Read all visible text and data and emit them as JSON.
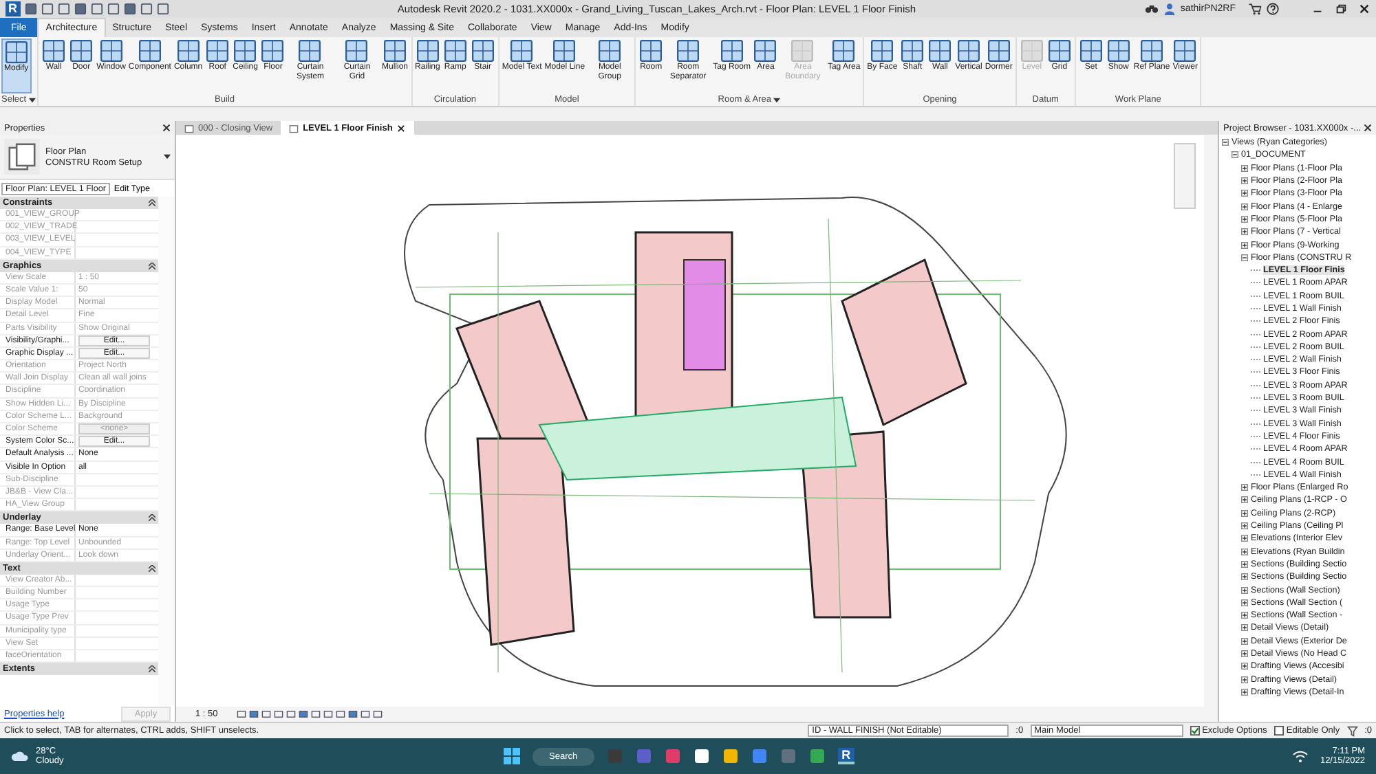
{
  "window": {
    "app_logo": "R",
    "title": "Autodesk Revit 2020.2 - 1031.XX000x - Grand_Living_Tuscan_Lakes_Arch.rvt - Floor Plan: LEVEL 1 Floor Finish",
    "user": "sathirPN2RF"
  },
  "ribbon_tabs": [
    {
      "label": "File",
      "selected": false,
      "kind": "file"
    },
    {
      "label": "Architecture",
      "selected": true,
      "kind": "tab"
    },
    {
      "label": "Structure",
      "selected": false,
      "kind": "tab"
    },
    {
      "label": "Steel",
      "selected": false,
      "kind": "tab"
    },
    {
      "label": "Systems",
      "selected": false,
      "kind": "tab"
    },
    {
      "label": "Insert",
      "selected": false,
      "kind": "tab"
    },
    {
      "label": "Annotate",
      "selected": false,
      "kind": "tab"
    },
    {
      "label": "Analyze",
      "selected": false,
      "kind": "tab"
    },
    {
      "label": "Massing & Site",
      "selected": false,
      "kind": "tab"
    },
    {
      "label": "Collaborate",
      "selected": false,
      "kind": "tab"
    },
    {
      "label": "View",
      "selected": false,
      "kind": "tab"
    },
    {
      "label": "Manage",
      "selected": false,
      "kind": "tab"
    },
    {
      "label": "Add-Ins",
      "selected": false,
      "kind": "tab"
    },
    {
      "label": "Modify",
      "selected": false,
      "kind": "tab"
    }
  ],
  "ribbon_panels": [
    {
      "title": "Select",
      "dropdown": true,
      "tools": [
        {
          "label": "Modify",
          "selected": true,
          "disabled": false
        }
      ]
    },
    {
      "title": "Build",
      "dropdown": false,
      "tools": [
        {
          "label": "Wall",
          "selected": false,
          "disabled": false
        },
        {
          "label": "Door",
          "selected": false,
          "disabled": false
        },
        {
          "label": "Window",
          "selected": false,
          "disabled": false
        },
        {
          "label": "Component",
          "selected": false,
          "disabled": false
        },
        {
          "label": "Column",
          "selected": false,
          "disabled": false
        },
        {
          "label": "Roof",
          "selected": false,
          "disabled": false
        },
        {
          "label": "Ceiling",
          "selected": false,
          "disabled": false
        },
        {
          "label": "Floor",
          "selected": false,
          "disabled": false
        },
        {
          "label": "Curtain System",
          "selected": false,
          "disabled": false
        },
        {
          "label": "Curtain Grid",
          "selected": false,
          "disabled": false
        },
        {
          "label": "Mullion",
          "selected": false,
          "disabled": false
        }
      ]
    },
    {
      "title": "Circulation",
      "dropdown": false,
      "tools": [
        {
          "label": "Railing",
          "selected": false,
          "disabled": false
        },
        {
          "label": "Ramp",
          "selected": false,
          "disabled": false
        },
        {
          "label": "Stair",
          "selected": false,
          "disabled": false
        }
      ]
    },
    {
      "title": "Model",
      "dropdown": false,
      "tools": [
        {
          "label": "Model Text",
          "selected": false,
          "disabled": false
        },
        {
          "label": "Model Line",
          "selected": false,
          "disabled": false
        },
        {
          "label": "Model Group",
          "selected": false,
          "disabled": false
        }
      ]
    },
    {
      "title": "Room & Area",
      "dropdown": true,
      "tools": [
        {
          "label": "Room",
          "selected": false,
          "disabled": false
        },
        {
          "label": "Room Separator",
          "selected": false,
          "disabled": false
        },
        {
          "label": "Tag Room",
          "selected": false,
          "disabled": false
        },
        {
          "label": "Area",
          "selected": false,
          "disabled": false
        },
        {
          "label": "Area Boundary",
          "selected": false,
          "disabled": true
        },
        {
          "label": "Tag Area",
          "selected": false,
          "disabled": false
        }
      ]
    },
    {
      "title": "Opening",
      "dropdown": false,
      "tools": [
        {
          "label": "By Face",
          "selected": false,
          "disabled": false
        },
        {
          "label": "Shaft",
          "selected": false,
          "disabled": false
        },
        {
          "label": "Wall",
          "selected": false,
          "disabled": false
        },
        {
          "label": "Vertical",
          "selected": false,
          "disabled": false
        },
        {
          "label": "Dormer",
          "selected": false,
          "disabled": false
        }
      ]
    },
    {
      "title": "Datum",
      "dropdown": false,
      "tools": [
        {
          "label": "Level",
          "selected": false,
          "disabled": true
        },
        {
          "label": "Grid",
          "selected": false,
          "disabled": false
        }
      ]
    },
    {
      "title": "Work Plane",
      "dropdown": false,
      "tools": [
        {
          "label": "Set",
          "selected": false,
          "disabled": false
        },
        {
          "label": "Show",
          "selected": false,
          "disabled": false
        },
        {
          "label": "Ref Plane",
          "selected": false,
          "disabled": false
        },
        {
          "label": "Viewer",
          "selected": false,
          "disabled": false
        }
      ]
    }
  ],
  "properties": {
    "title": "Properties",
    "type_name": "Floor Plan",
    "type_sub": "CONSTRU Room Setup",
    "instance": "Floor Plan: LEVEL 1 Floor",
    "edit_type": "Edit Type",
    "groups": [
      {
        "title": "Constraints",
        "rows": [
          {
            "label": "001_VIEW_GROUP",
            "value": "",
            "kind": "text",
            "editable": false
          },
          {
            "label": "002_VIEW_TRADE",
            "value": "",
            "kind": "text",
            "editable": false
          },
          {
            "label": "003_VIEW_LEVEL",
            "value": "",
            "kind": "text",
            "editable": false
          },
          {
            "label": "004_VIEW_TYPE",
            "value": "",
            "kind": "text",
            "editable": false
          }
        ]
      },
      {
        "title": "Graphics",
        "rows": [
          {
            "label": "View Scale",
            "value": "1 : 50",
            "kind": "text",
            "editable": false
          },
          {
            "label": "Scale Value    1:",
            "value": "50",
            "kind": "text",
            "editable": false
          },
          {
            "label": "Display Model",
            "value": "Normal",
            "kind": "text",
            "editable": false
          },
          {
            "label": "Detail Level",
            "value": "Fine",
            "kind": "text",
            "editable": false
          },
          {
            "label": "Parts Visibility",
            "value": "Show Original",
            "kind": "text",
            "editable": false
          },
          {
            "label": "Visibility/Graphi...",
            "value": "Edit...",
            "kind": "button",
            "editable": true
          },
          {
            "label": "Graphic Display ...",
            "value": "Edit...",
            "kind": "button",
            "editable": true
          },
          {
            "label": "Orientation",
            "value": "Project North",
            "kind": "text",
            "editable": false
          },
          {
            "label": "Wall Join Display",
            "value": "Clean all wall joins",
            "kind": "text",
            "editable": false
          },
          {
            "label": "Discipline",
            "value": "Coordination",
            "kind": "text",
            "editable": false
          },
          {
            "label": "Show Hidden Li...",
            "value": "By Discipline",
            "kind": "text",
            "editable": false
          },
          {
            "label": "Color Scheme L...",
            "value": "Background",
            "kind": "text",
            "editable": false
          },
          {
            "label": "Color Scheme",
            "value": "<none>",
            "kind": "button",
            "editable": false
          },
          {
            "label": "System Color Sc...",
            "value": "Edit...",
            "kind": "button",
            "editable": true
          },
          {
            "label": "Default Analysis ...",
            "value": "None",
            "kind": "text",
            "editable": true
          },
          {
            "label": "Visible In Option",
            "value": "all",
            "kind": "text",
            "editable": true
          },
          {
            "label": "Sub-Discipline",
            "value": "",
            "kind": "text",
            "editable": false
          },
          {
            "label": "JB&B - View Cla...",
            "value": "",
            "kind": "text",
            "editable": false
          },
          {
            "label": "HA_View Group",
            "value": "",
            "kind": "text",
            "editable": false
          }
        ]
      },
      {
        "title": "Underlay",
        "rows": [
          {
            "label": "Range: Base Level",
            "value": "None",
            "kind": "text",
            "editable": true
          },
          {
            "label": "Range: Top Level",
            "value": "Unbounded",
            "kind": "text",
            "editable": false
          },
          {
            "label": "Underlay Orient...",
            "value": "Look down",
            "kind": "text",
            "editable": false
          }
        ]
      },
      {
        "title": "Text",
        "rows": [
          {
            "label": "View Creator Ab...",
            "value": "",
            "kind": "text",
            "editable": false
          },
          {
            "label": "Building Number",
            "value": "",
            "kind": "text",
            "editable": false
          },
          {
            "label": "Usage Type",
            "value": "",
            "kind": "text",
            "editable": false
          },
          {
            "label": "Usage Type Prev",
            "value": "",
            "kind": "text",
            "editable": false
          },
          {
            "label": "Municipality type",
            "value": "",
            "kind": "text",
            "editable": false
          },
          {
            "label": "View Set",
            "value": "",
            "kind": "text",
            "editable": false
          },
          {
            "label": "faceOrientation",
            "value": "",
            "kind": "text",
            "editable": false
          }
        ]
      },
      {
        "title": "Extents"
      }
    ],
    "help_link": "Properties help",
    "apply": "Apply",
    "apply_disabled": true
  },
  "view_tabs": [
    {
      "label": "000 - Closing View",
      "selected": false
    },
    {
      "label": "LEVEL 1 Floor Finish",
      "selected": true
    }
  ],
  "view_scale": "1 : 50",
  "project_browser": {
    "title": "Project Browser - 1031.XX000x -...",
    "tree": [
      {
        "label": "Views (Ryan Categories)",
        "expanded": true,
        "selected": false,
        "children": [
          {
            "label": "01_DOCUMENT",
            "expanded": true,
            "selected": false,
            "children": [
              {
                "label": "Floor Plans (1-Floor Pla",
                "expanded": false,
                "selected": false
              },
              {
                "label": "Floor Plans (2-Floor Pla",
                "expanded": false,
                "selected": false
              },
              {
                "label": "Floor Plans (3-Floor Pla",
                "expanded": false,
                "selected": false
              },
              {
                "label": "Floor Plans (4 - Enlarge",
                "expanded": false,
                "selected": false
              },
              {
                "label": "Floor Plans (5-Floor Pla",
                "expanded": false,
                "selected": false
              },
              {
                "label": "Floor Plans (7 - Vertical",
                "expanded": false,
                "selected": false
              },
              {
                "label": "Floor Plans (9-Working",
                "expanded": false,
                "selected": false
              },
              {
                "label": "Floor Plans (CONSTRU R",
                "expanded": true,
                "selected": false,
                "children": [
                  {
                    "label": "LEVEL 1 Floor Finis",
                    "selected": true
                  },
                  {
                    "label": "LEVEL 1 Room APAR",
                    "selected": false
                  },
                  {
                    "label": "LEVEL 1 Room BUIL",
                    "selected": false
                  },
                  {
                    "label": "LEVEL 1 Wall Finish",
                    "selected": false
                  },
                  {
                    "label": "LEVEL 2 Floor Finis",
                    "selected": false
                  },
                  {
                    "label": "LEVEL 2 Room APAR",
                    "selected": false
                  },
                  {
                    "label": "LEVEL 2 Room BUIL",
                    "selected": false
                  },
                  {
                    "label": "LEVEL 2 Wall Finish",
                    "selected": false
                  },
                  {
                    "label": "LEVEL 3 Floor Finis",
                    "selected": false
                  },
                  {
                    "label": "LEVEL 3 Room APAR",
                    "selected": false
                  },
                  {
                    "label": "LEVEL 3 Room BUIL",
                    "selected": false
                  },
                  {
                    "label": "LEVEL 3 Wall Finish",
                    "selected": false
                  },
                  {
                    "label": "LEVEL 3 Wall Finish",
                    "selected": false
                  },
                  {
                    "label": "LEVEL 4 Floor Finis",
                    "selected": false
                  },
                  {
                    "label": "LEVEL 4 Room APAR",
                    "selected": false
                  },
                  {
                    "label": "LEVEL 4 Room BUIL",
                    "selected": false
                  },
                  {
                    "label": "LEVEL 4 Wall Finish",
                    "selected": false
                  }
                ]
              },
              {
                "label": "Floor Plans (Enlarged Ro",
                "expanded": false,
                "selected": false
              },
              {
                "label": "Ceiling Plans (1-RCP - O",
                "expanded": false,
                "selected": false
              },
              {
                "label": "Ceiling Plans (2-RCP)",
                "expanded": false,
                "selected": false
              },
              {
                "label": "Ceiling Plans (Ceiling Pl",
                "expanded": false,
                "selected": false
              },
              {
                "label": "Elevations (Interior Elev",
                "expanded": false,
                "selected": false
              },
              {
                "label": "Elevations (Ryan Buildin",
                "expanded": false,
                "selected": false
              },
              {
                "label": "Sections (Building Sectio",
                "expanded": false,
                "selected": false
              },
              {
                "label": "Sections (Building Sectio",
                "expanded": false,
                "selected": false
              },
              {
                "label": "Sections (Wall Section)",
                "expanded": false,
                "selected": false
              },
              {
                "label": "Sections (Wall Section (",
                "expanded": false,
                "selected": false
              },
              {
                "label": "Sections (Wall Section -",
                "expanded": false,
                "selected": false
              },
              {
                "label": "Detail Views (Detail)",
                "expanded": false,
                "selected": false
              },
              {
                "label": "Detail Views (Exterior De",
                "expanded": false,
                "selected": false
              },
              {
                "label": "Detail Views (No Head C",
                "expanded": false,
                "selected": false
              },
              {
                "label": "Drafting Views (Accesibi",
                "expanded": false,
                "selected": false
              },
              {
                "label": "Drafting Views (Detail)",
                "expanded": false,
                "selected": false
              },
              {
                "label": "Drafting Views (Detail-In",
                "expanded": false,
                "selected": false
              }
            ]
          }
        ]
      }
    ]
  },
  "status_bar": {
    "hint": "Click to select, TAB for alternates, CTRL adds, SHIFT unselects.",
    "workset": "ID - WALL FINISH (Not Editable)",
    "workset_count": ":0",
    "design_option": "Main Model",
    "exclude_options": {
      "label": "Exclude Options",
      "checked": true
    },
    "editable_only": {
      "label": "Editable Only",
      "checked": false
    },
    "filter_count": ":0"
  },
  "taskbar": {
    "temperature": "28°C",
    "weather": "Cloudy",
    "search": "Search",
    "revit_label": "R",
    "time": "7:11 PM",
    "date": "12/15/2022"
  }
}
